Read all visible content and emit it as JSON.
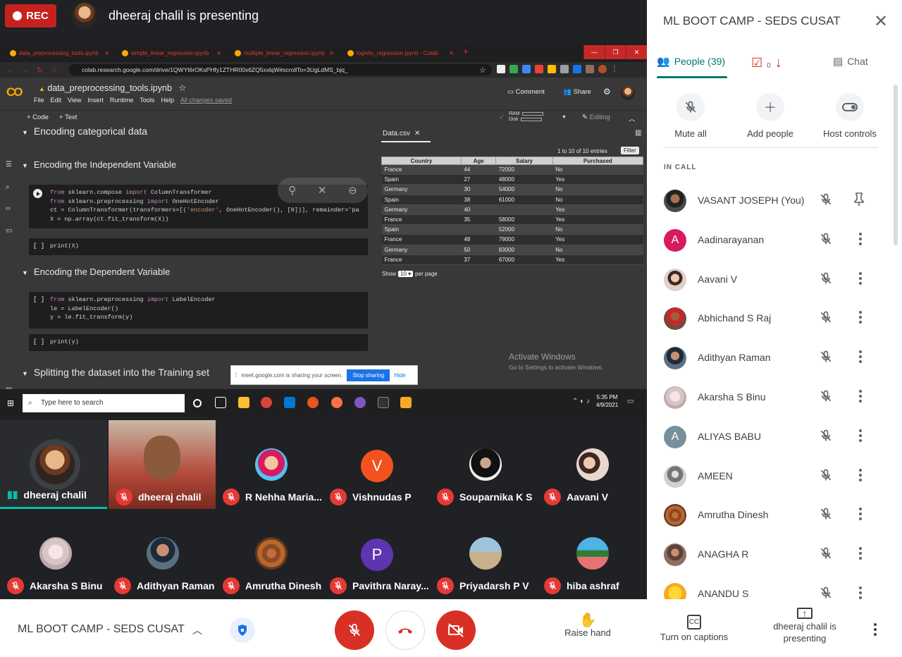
{
  "top": {
    "rec_label": "REC",
    "presenting_text": "dheeraj chalil is presenting"
  },
  "browser": {
    "tabs": [
      "data_preprocessing_tools.ipynb",
      "simple_linear_regression.ipynb",
      "multiple_linear_regression.ipynb",
      "logistic_regression.ipynb - Colab"
    ],
    "url": "colab.research.google.com/drive/1QWYt6rOKsPHfy1ZTHR00x6ZQ5xxlqW#scrollTo=3UgLdMS_bjq_"
  },
  "colab": {
    "logo": "CO",
    "notebook_title": "data_preprocessing_tools.ipynb",
    "menus": [
      "File",
      "Edit",
      "View",
      "Insert",
      "Runtime",
      "Tools",
      "Help"
    ],
    "saved": "All changes saved",
    "comment": "Comment",
    "share": "Share",
    "add_code": "+ Code",
    "add_text": "+ Text",
    "ram": "RAM",
    "disk": "Disk",
    "editing": "Editing",
    "sections": {
      "s1": "Encoding categorical data",
      "s2": "Encoding the Independent Variable",
      "s3": "Encoding the Dependent Variable",
      "s4": "Splitting the dataset into the Training set"
    },
    "cell1": [
      "from sklearn.compose import ColumnTransformer",
      "from sklearn.preprocessing import OneHotEncoder",
      "ct = ColumnTransformer(transformers=[('encoder', OneHotEncoder(), [0])], remainder='pa",
      "X = np.array(ct.fit_transform(X))"
    ],
    "cell2": "print(X)",
    "cell3": [
      "from sklearn.preprocessing import LabelEncoder",
      "le = LabelEncoder()",
      "y = le.fit_transform(y)"
    ],
    "cell4": "print(y)",
    "bracket": "[ ]"
  },
  "datafile": {
    "tab": "Data.csv",
    "entries": "1 to 10 of 10 entries",
    "filter": "Filter",
    "columns": [
      "Country",
      "Age",
      "Salary",
      "Purchased"
    ],
    "rows": [
      [
        "France",
        "44",
        "72000",
        "No"
      ],
      [
        "Spain",
        "27",
        "48000",
        "Yes"
      ],
      [
        "Germany",
        "30",
        "54000",
        "No"
      ],
      [
        "Spain",
        "38",
        "61000",
        "No"
      ],
      [
        "Germany",
        "40",
        "",
        "Yes"
      ],
      [
        "France",
        "35",
        "58000",
        "Yes"
      ],
      [
        "Spain",
        "",
        "52000",
        "No"
      ],
      [
        "France",
        "48",
        "79000",
        "Yes"
      ],
      [
        "Germany",
        "50",
        "83000",
        "No"
      ],
      [
        "France",
        "37",
        "67000",
        "Yes"
      ]
    ],
    "show": "Show",
    "show_value": "10",
    "per_page": "per page"
  },
  "windows": {
    "activate_title": "Activate Windows",
    "activate_sub": "Go to Settings to activate Windows.",
    "sharing_text": "meet.google.com is sharing your screen.",
    "stop_sharing": "Stop sharing",
    "hide": "Hide",
    "search_placeholder": "Type here to search",
    "time": "5:35 PM",
    "date": "4/9/2021"
  },
  "tiles": [
    {
      "name": "dheeraj chalil"
    },
    {
      "name": "dheeraj chalil"
    },
    {
      "name": "R Nehha Maria..."
    },
    {
      "name": "Vishnudas P",
      "letter": "V"
    },
    {
      "name": "Souparnika K S"
    },
    {
      "name": "Aavani V"
    },
    {
      "name": "Akarsha S Binu"
    },
    {
      "name": "Adithyan Raman"
    },
    {
      "name": "Amrutha Dinesh"
    },
    {
      "name": "Pavithra Naray...",
      "letter": "P"
    },
    {
      "name": "Priyadarsh P V"
    },
    {
      "name": "hiba ashraf"
    }
  ],
  "panel": {
    "title": "ML BOOT CAMP - SEDS CUSAT",
    "people_tab": "People (39)",
    "tasks_count": "0",
    "chat_tab": "Chat",
    "mute_all": "Mute all",
    "add_people": "Add people",
    "host_controls": "Host controls",
    "in_call": "IN CALL",
    "participants": [
      {
        "name": "VASANT JOSEPH (You)"
      },
      {
        "name": "Aadinarayanan",
        "letter": "A",
        "color": "#d81b60"
      },
      {
        "name": "Aavani V"
      },
      {
        "name": "Abhichand S Raj"
      },
      {
        "name": "Adithyan Raman"
      },
      {
        "name": "Akarsha S Binu"
      },
      {
        "name": "ALIYAS BABU",
        "letter": "A",
        "color": "#78909c"
      },
      {
        "name": "AMEEN"
      },
      {
        "name": "Amrutha Dinesh"
      },
      {
        "name": "ANAGHA R"
      },
      {
        "name": "ANANDU S"
      }
    ]
  },
  "bottom": {
    "meeting_title": "ML BOOT CAMP - SEDS CUSAT",
    "raise_hand": "Raise hand",
    "captions": "Turn on captions",
    "presenting": "dheeraj chalil is presenting"
  },
  "colors": {
    "accent": "#00796b",
    "danger": "#e53935",
    "rec": "#c5221f"
  }
}
